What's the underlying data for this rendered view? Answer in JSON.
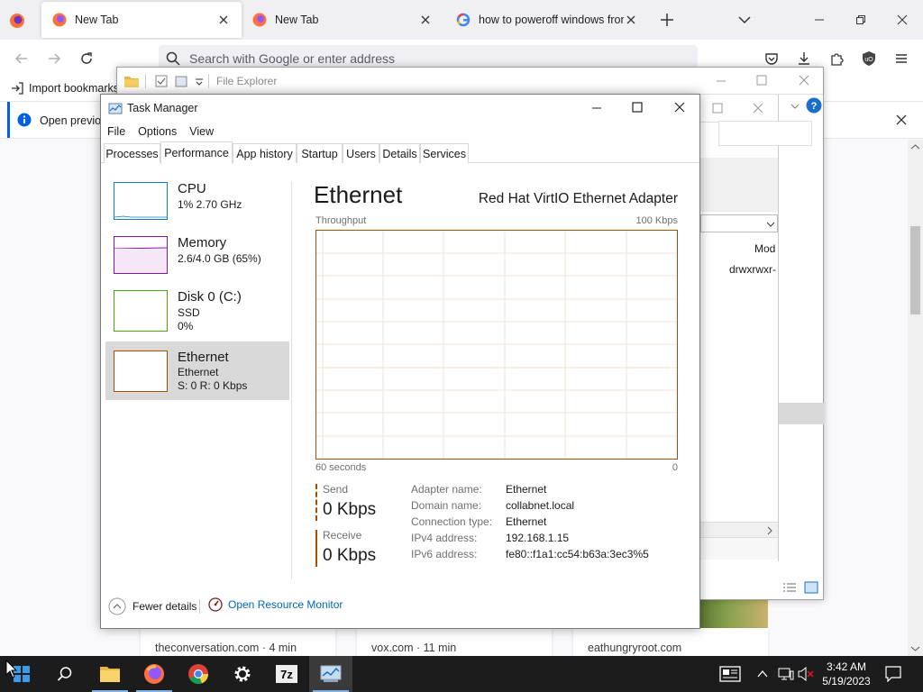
{
  "firefox": {
    "tabs": [
      {
        "label": "New Tab",
        "active": true
      },
      {
        "label": "New Tab",
        "active": false
      },
      {
        "label": "how to poweroff windows from",
        "active": false
      }
    ],
    "address_placeholder": "Search with Google or enter address",
    "bookmarks": {
      "import_label": "Import bookmarks"
    },
    "infobar": {
      "message": "Open previo"
    },
    "cards": [
      {
        "site": "theconversation.com",
        "read_time": "4 min"
      },
      {
        "site": "vox.com",
        "read_time": "11 min"
      },
      {
        "site": "eathungryroot.com",
        "read_time": ""
      }
    ]
  },
  "file_explorer": {
    "title": "File Explorer",
    "columns": {
      "mode_header": "Mod"
    },
    "row_value": "drwxrwxr-"
  },
  "task_manager": {
    "title": "Task Manager",
    "menu": [
      "File",
      "Options",
      "View"
    ],
    "tabs": [
      "Processes",
      "Performance",
      "App history",
      "Startup",
      "Users",
      "Details",
      "Services"
    ],
    "active_tab": "Performance",
    "resources": [
      {
        "name": "CPU",
        "line1": "1%  2.70 GHz",
        "line2": "",
        "color": "#1179c4"
      },
      {
        "name": "Memory",
        "line1": "2.6/4.0 GB (65%)",
        "line2": "",
        "color": "#8b12ae"
      },
      {
        "name": "Disk 0 (C:)",
        "line1": "SSD",
        "line2": "0%",
        "color": "#4da60c"
      },
      {
        "name": "Ethernet",
        "line1": "Ethernet",
        "line2": "S: 0  R: 0 Kbps",
        "color": "#a74f01",
        "selected": true
      }
    ],
    "detail": {
      "title": "Ethernet",
      "adapter": "Red Hat VirtIO Ethernet Adapter",
      "graph_label": "Throughput",
      "graph_max": "100 Kbps",
      "graph_time": "60 seconds",
      "graph_min": "0",
      "send_label": "Send",
      "send_value": "0 Kbps",
      "receive_label": "Receive",
      "receive_value": "0 Kbps",
      "info": [
        {
          "key": "Adapter name:",
          "value": "Ethernet"
        },
        {
          "key": "Domain name:",
          "value": "collabnet.local"
        },
        {
          "key": "Connection type:",
          "value": "Ethernet"
        },
        {
          "key": "IPv4 address:",
          "value": "192.168.1.15"
        },
        {
          "key": "IPv6 address:",
          "value": "fe80::f1a1:cc54:b63a:3ec3%5"
        }
      ]
    },
    "footer": {
      "fewer_details": "Fewer details",
      "resource_monitor": "Open Resource Monitor"
    }
  },
  "taskbar": {
    "time": "3:42 AM",
    "date": "5/19/2023",
    "pinned": [
      "start",
      "search",
      "file-explorer",
      "firefox",
      "chrome",
      "settings",
      "7zip",
      "task-manager"
    ]
  },
  "colors": {
    "ethernet": "#a74f01",
    "cpu": "#1179c4",
    "memory": "#8b12ae",
    "disk": "#4da60c",
    "link": "#0066b4",
    "taskbar": "#1c1c1c"
  }
}
